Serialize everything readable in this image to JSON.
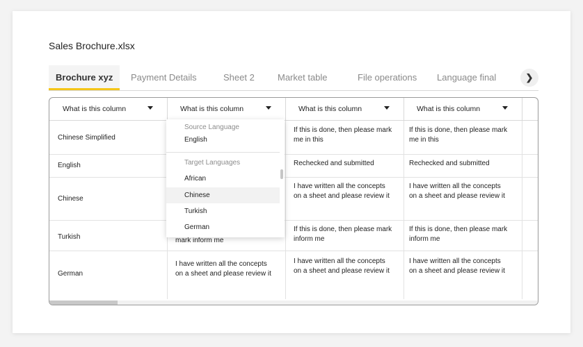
{
  "file_title": "Sales Brochure.xlsx",
  "tabs": [
    {
      "label": "Brochure xyz",
      "active": true
    },
    {
      "label": "Payment Details",
      "active": false
    },
    {
      "label": "Sheet 2",
      "active": false
    },
    {
      "label": "Market table",
      "active": false
    },
    {
      "label": "File operations",
      "active": false
    },
    {
      "label": "Language final",
      "active": false
    }
  ],
  "tab_next_icon": "chevron-right",
  "columns": [
    {
      "header": "What is this column"
    },
    {
      "header": "What is this column"
    },
    {
      "header": "What is this column"
    },
    {
      "header": "What is this column"
    }
  ],
  "rows": [
    {
      "language": "Chinese Simplified",
      "col2": "",
      "col3": "If this is done, then please mark me in this",
      "col4": "If this is done, then please mark me in this"
    },
    {
      "language": "English",
      "col2": "",
      "col3": "Rechecked and submitted",
      "col4": "Rechecked and submitted"
    },
    {
      "language": "Chinese",
      "col2": "",
      "col3": "I have written all the concepts on a sheet and please review it",
      "col4": "I have written all the concepts on a sheet and please review it"
    },
    {
      "language": "Turkish",
      "col2": "mark inform me",
      "col3": "If this is done, then please mark inform me",
      "col4": "If this is done, then please mark inform me"
    },
    {
      "language": "German",
      "col2": "I have written all the concepts on a sheet and please review it",
      "col3": "I have written all the concepts on a sheet and please review it",
      "col4": "I have written all the concepts on a sheet and please review it"
    }
  ],
  "dropdown": {
    "source_heading": "Source Language",
    "source_value": "English",
    "target_heading": "Target Languages",
    "targets": [
      "African",
      "Chinese",
      "Turkish",
      "German"
    ],
    "hovered": "Chinese"
  }
}
